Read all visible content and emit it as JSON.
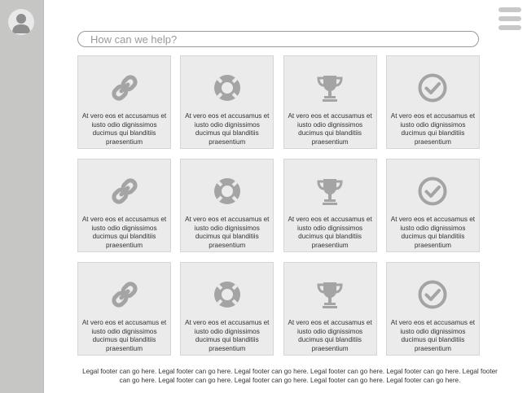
{
  "search": {
    "placeholder": "How can we help?"
  },
  "sidebar": {
    "avatar_icon": "user-avatar-icon"
  },
  "header": {
    "menu_icon": "hamburger-menu-icon"
  },
  "cards": [
    {
      "icon": "link-icon",
      "text": "At vero eos et accusamus et iusto odio dignissimos ducimus qui blanditiis praesentium"
    },
    {
      "icon": "lifebuoy-icon",
      "text": "At vero eos et accusamus et iusto odio dignissimos ducimus qui blanditiis praesentium"
    },
    {
      "icon": "trophy-icon",
      "text": "At vero eos et accusamus et iusto odio dignissimos ducimus qui blanditiis praesentium"
    },
    {
      "icon": "check-circle-icon",
      "text": "At vero eos et accusamus et iusto odio dignissimos ducimus qui blanditiis praesentium"
    },
    {
      "icon": "link-icon",
      "text": "At vero eos et accusamus et iusto odio dignissimos ducimus qui blanditiis praesentium"
    },
    {
      "icon": "lifebuoy-icon",
      "text": "At vero eos et accusamus et iusto odio dignissimos ducimus qui blanditiis praesentium"
    },
    {
      "icon": "trophy-icon",
      "text": "At vero eos et accusamus et iusto odio dignissimos ducimus qui blanditiis praesentium"
    },
    {
      "icon": "check-circle-icon",
      "text": "At vero eos et accusamus et iusto odio dignissimos ducimus qui blanditiis praesentium"
    },
    {
      "icon": "link-icon",
      "text": "At vero eos et accusamus et iusto odio dignissimos ducimus qui blanditiis praesentium"
    },
    {
      "icon": "lifebuoy-icon",
      "text": "At vero eos et accusamus et iusto odio dignissimos ducimus qui blanditiis praesentium"
    },
    {
      "icon": "trophy-icon",
      "text": "At vero eos et accusamus et iusto odio dignissimos ducimus qui blanditiis praesentium"
    },
    {
      "icon": "check-circle-icon",
      "text": "At vero eos et accusamus et iusto odio dignissimos ducimus qui blanditiis praesentium"
    }
  ],
  "footer": {
    "text": "Legal footer can go here. Legal footer can go here. Legal footer can go here. Legal footer can go here. Legal footer can go here. Legal footer can go here. Legal footer can go here. Legal footer can go here. Legal footer can go here. Legal footer can go here."
  },
  "colors": {
    "sidebar": "#c6c7c4",
    "card_background": "#ebebeb",
    "icon": "#a4a4a4",
    "menu_bars": "#c8c8c8"
  }
}
